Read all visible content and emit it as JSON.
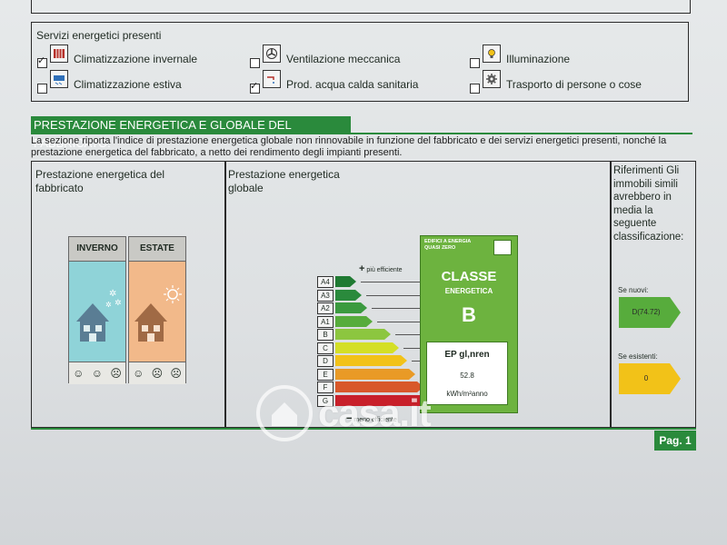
{
  "services": {
    "title": "Servizi energetici presenti",
    "items": [
      {
        "label": "Climatizzazione invernale",
        "checked": true,
        "icon": "radiator-icon"
      },
      {
        "label": "Climatizzazione estiva",
        "checked": false,
        "icon": "air-conditioner-icon"
      },
      {
        "label": "Ventilazione meccanica",
        "checked": false,
        "icon": "fan-icon"
      },
      {
        "label": "Prod. acqua calda sanitaria",
        "checked": true,
        "icon": "faucet-icon"
      },
      {
        "label": "Illuminazione",
        "checked": false,
        "icon": "lightbulb-icon"
      },
      {
        "label": "Trasporto di persone o cose",
        "checked": false,
        "icon": "gear-icon"
      }
    ]
  },
  "section": {
    "title": "PRESTAZIONE ENERGETICA E GLOBALE DEL FABBRICATO.",
    "description": "La sezione riporta l'indice di prestazione energetica globale non rinnovabile in funzione del fabbricato e dei servizi energetici presenti, nonché la prestazione energetica del fabbricato, a netto dei rendimento degli impianti presenti."
  },
  "fabbricato": {
    "title": "Prestazione energetica del fabbricato",
    "winter_label": "INVERNO",
    "summer_label": "ESTATE"
  },
  "globale": {
    "title": "Prestazione energetica globale",
    "more_efficient": "più efficiente",
    "less_efficient": "meno efficiente",
    "classes": [
      "A4",
      "A3",
      "A2",
      "A1",
      "B",
      "C",
      "D",
      "E",
      "F",
      "G"
    ],
    "class_colors": [
      "#1f7a32",
      "#2a8a3c",
      "#3b9a3f",
      "#57ac3c",
      "#8cc63f",
      "#d4df26",
      "#f2c218",
      "#e99a26",
      "#d8582a",
      "#c8202a"
    ]
  },
  "classe": {
    "nzeb_label": "EDIFICI A ENERGIA QUASI ZERO",
    "title": "CLASSE",
    "subtitle": "ENERGETICA",
    "letter": "B",
    "ep_label": "EP gl,nren",
    "ep_value": "52.8",
    "ep_unit": "kWh/m²anno"
  },
  "riferimenti": {
    "title": "Riferimenti Gli immobili simili avrebbero in media la seguente classificazione:",
    "new_label": "Se nuovi:",
    "new_value": "D(74.72)",
    "new_color": "#57ac3c",
    "existing_label": "Se esistenti:",
    "existing_value": "0",
    "existing_color": "#f2c218"
  },
  "page": {
    "label": "Pag. 1"
  },
  "watermark": {
    "text": "casa.it"
  }
}
